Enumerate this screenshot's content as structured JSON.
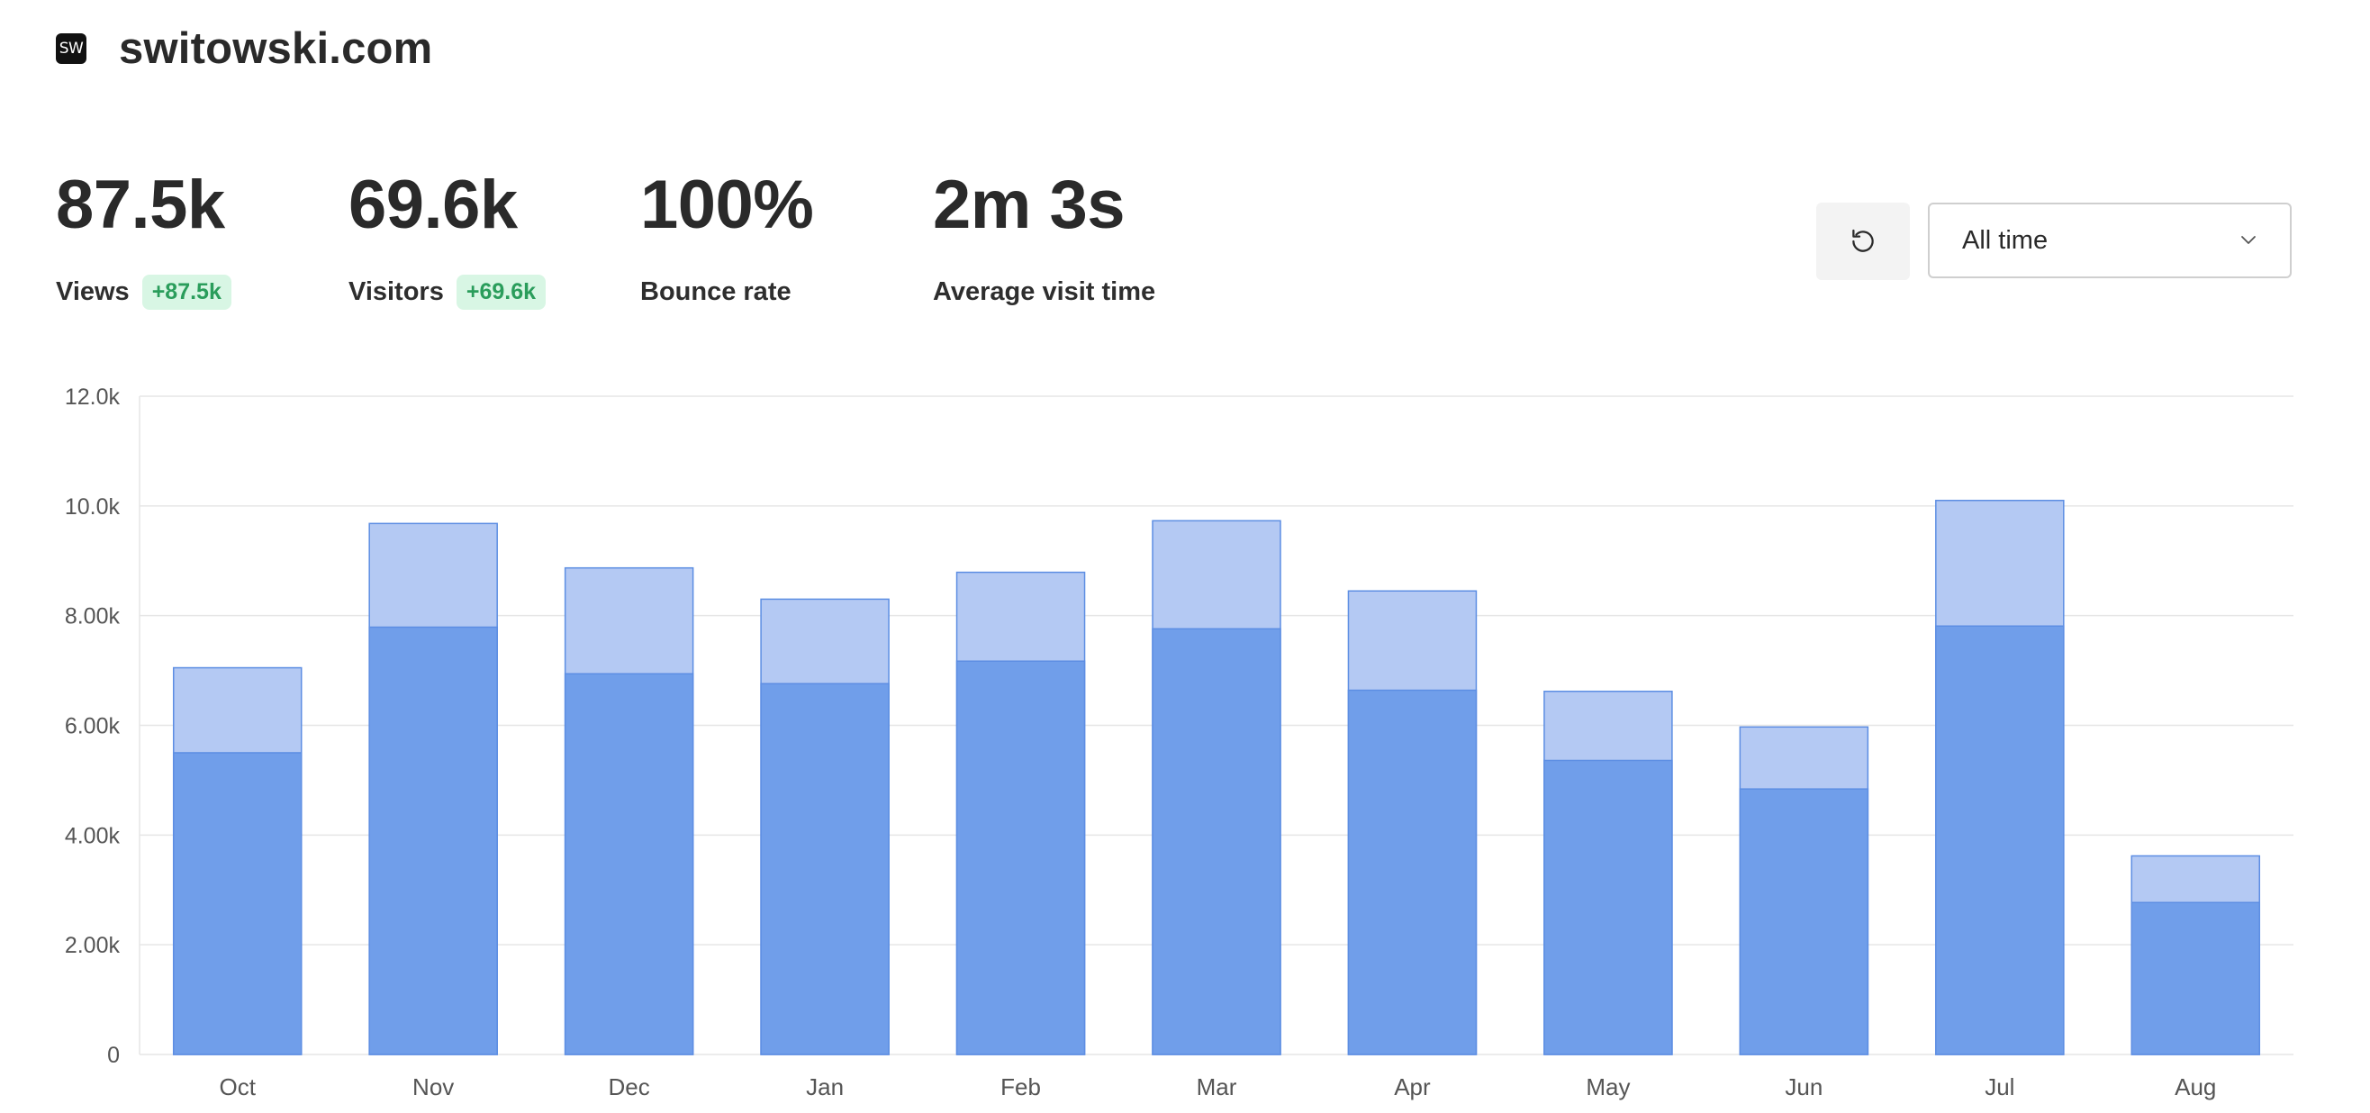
{
  "site": {
    "favicon_text": "SW",
    "title": "switowski.com"
  },
  "metrics": [
    {
      "value": "87.5k",
      "label": "Views",
      "badge": "+87.5k"
    },
    {
      "value": "69.6k",
      "label": "Visitors",
      "badge": "+69.6k"
    },
    {
      "value": "100%",
      "label": "Bounce rate"
    },
    {
      "value": "2m 3s",
      "label": "Average visit time"
    }
  ],
  "controls": {
    "refresh_icon": "refresh-icon",
    "date_range": "All time",
    "chevron_icon": "chevron-down-icon"
  },
  "chart_data": {
    "type": "bar",
    "categories": [
      "Oct",
      "Nov",
      "Dec",
      "Jan",
      "Feb",
      "Mar",
      "Apr",
      "May",
      "Jun",
      "Jul",
      "Aug"
    ],
    "series": [
      {
        "name": "",
        "values": [
          7050,
          9680,
          8870,
          8300,
          8790,
          9730,
          8450,
          6620,
          5970,
          10100,
          3620
        ],
        "color": "#b4c9f3"
      },
      {
        "name": "",
        "values": [
          5500,
          7790,
          6940,
          6760,
          7170,
          7760,
          6640,
          5360,
          4840,
          7810,
          2770
        ],
        "color": "#709eea"
      }
    ],
    "ylim": [
      0,
      12000
    ],
    "yticks": [
      "0",
      "2.00k",
      "4.00k",
      "6.00k",
      "8.00k",
      "10.0k",
      "12.0k"
    ],
    "grid": true,
    "stacked": false,
    "colors": {
      "border": "#5d8ee3",
      "grid": "#e6e6e6",
      "tick_text": "#555555"
    }
  }
}
